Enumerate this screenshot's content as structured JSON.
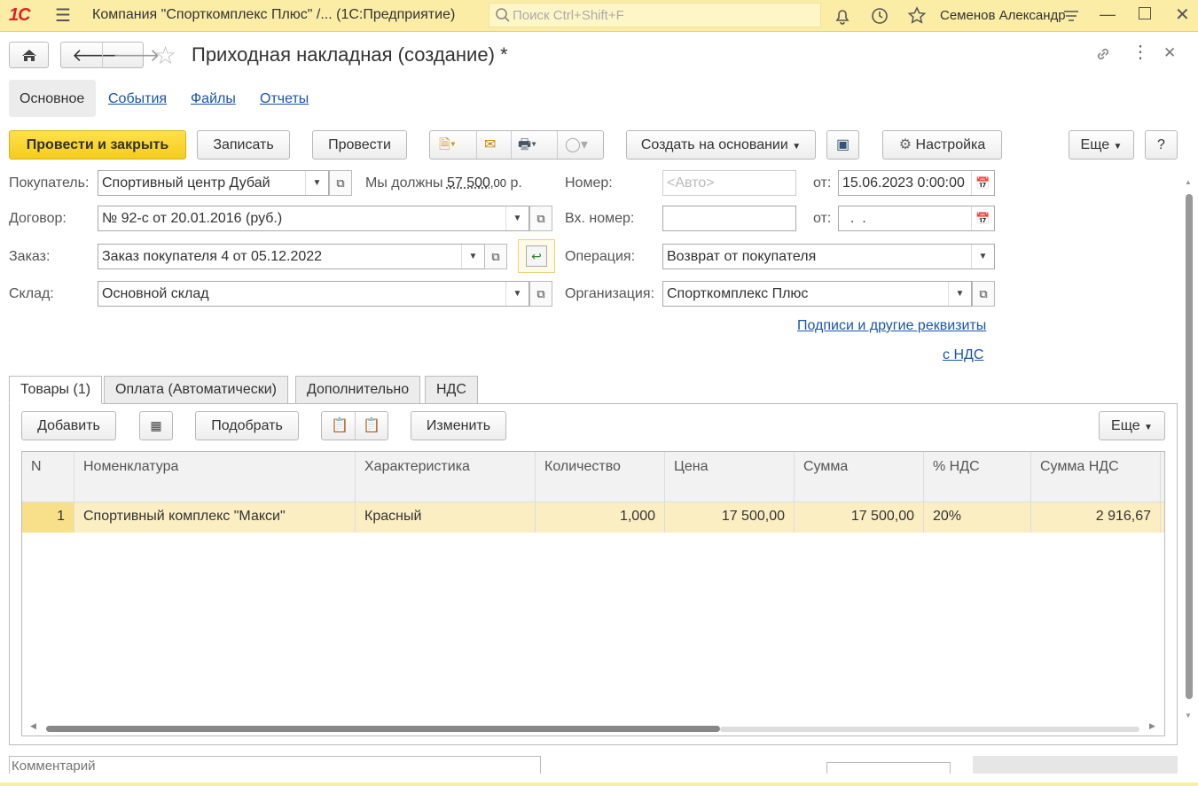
{
  "app": {
    "logo_text": "1С",
    "title": "Компания \"Спорткомплекс Плюс\" /...  (1С:Предприятие)",
    "search_placeholder": "Поиск Ctrl+Shift+F",
    "user": "Семенов Александр"
  },
  "document": {
    "title": "Приходная накладная (создание) *"
  },
  "nav_tabs": [
    {
      "label": "Основное"
    },
    {
      "label": "События"
    },
    {
      "label": "Файлы"
    },
    {
      "label": "Отчеты"
    }
  ],
  "toolbar": {
    "post_close": "Провести и закрыть",
    "save": "Записать",
    "post": "Провести",
    "create_based": "Создать на основании",
    "settings": "Настройка",
    "more": "Еще",
    "help": "?"
  },
  "form": {
    "buyer_label": "Покупатель:",
    "buyer_value": "Спортивный центр Дубай",
    "we_owe_label": "Мы должны",
    "we_owe_amount": "57 500",
    "we_owe_cents": ",00",
    "we_owe_currency": "р.",
    "number_label": "Номер:",
    "number_placeholder": "<Авто>",
    "date_label": "от:",
    "date_value": "15.06.2023  0:00:00",
    "contract_label": "Договор:",
    "contract_value": "№ 92-с от 20.01.2016 (руб.)",
    "in_number_label": "Вх. номер:",
    "in_number_value": "",
    "in_date_label": "от:",
    "in_date_value": "  .  .",
    "order_label": "Заказ:",
    "order_value": "Заказ покупателя 4 от 05.12.2022",
    "operation_label": "Операция:",
    "operation_value": "Возврат от покупателя",
    "warehouse_label": "Склад:",
    "warehouse_value": "Основной склад",
    "org_label": "Организация:",
    "org_value": "Спорткомплекс Плюс",
    "signatures_link": "Подписи и другие реквизиты",
    "vat_link": "с НДС"
  },
  "inner_tabs": [
    {
      "label": "Товары (1)"
    },
    {
      "label": "Оплата (Автоматически)"
    },
    {
      "label": "Дополнительно"
    },
    {
      "label": "НДС"
    }
  ],
  "table_toolbar": {
    "add": "Добавить",
    "pick": "Подобрать",
    "change": "Изменить",
    "more": "Еще"
  },
  "table": {
    "headers": [
      "N",
      "Номенклатура",
      "Характеристика",
      "Количество",
      "Цена",
      "Сумма",
      "% НДС",
      "Сумма НДС"
    ],
    "rows": [
      [
        "1",
        "Спортивный комплекс \"Макси\"",
        "Красный",
        "1,000",
        "17 500,00",
        "17 500,00",
        "20%",
        "2 916,67"
      ]
    ]
  },
  "footer": {
    "comment_placeholder": "Комментарий"
  }
}
